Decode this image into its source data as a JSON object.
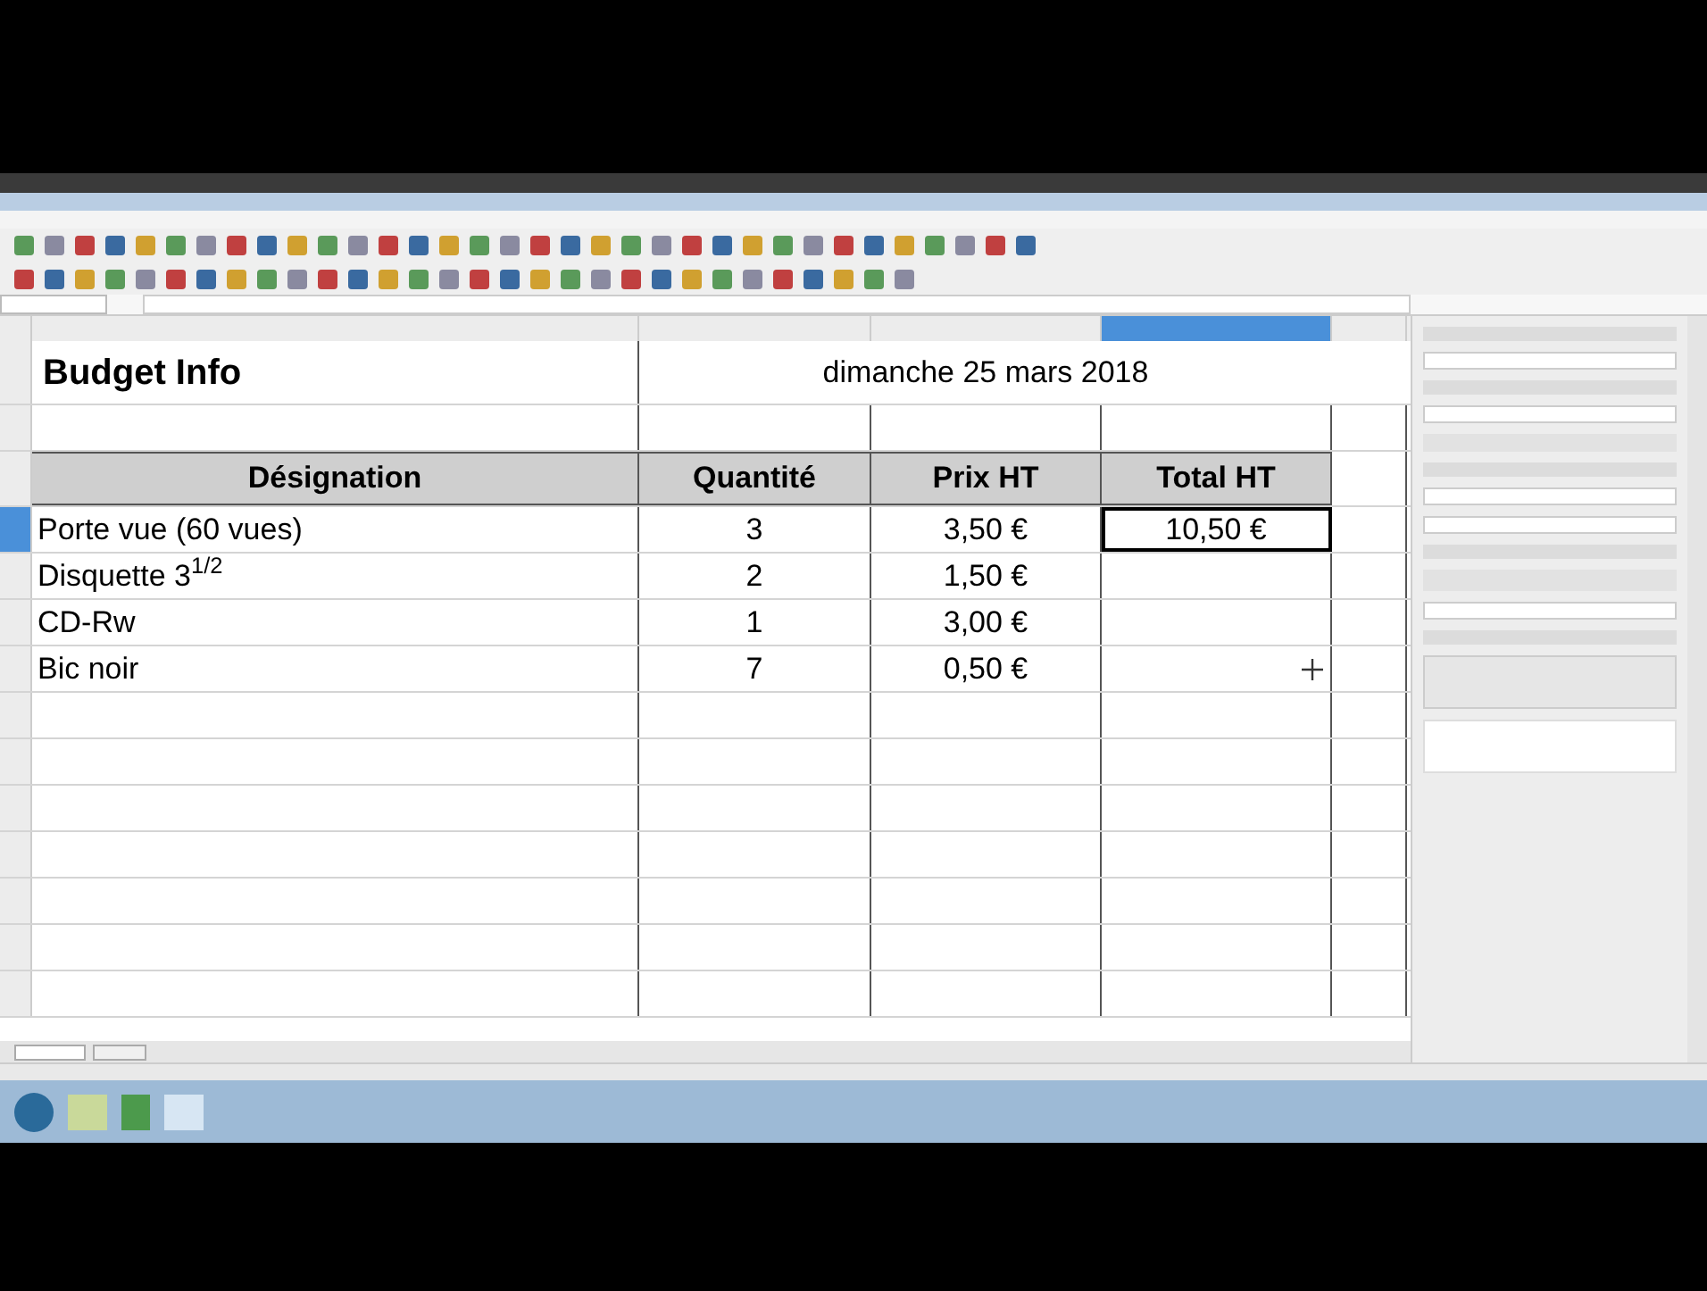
{
  "sheet": {
    "title_cell": "Budget Info",
    "date_cell": "dimanche 25 mars 2018",
    "columns": [
      {
        "selected": false
      },
      {
        "selected": false
      },
      {
        "selected": false
      },
      {
        "selected": true
      },
      {
        "selected": false
      }
    ],
    "header_row": [
      "Désignation",
      "Quantité",
      "Prix HT",
      "Total HT"
    ],
    "rows": [
      {
        "selected": true,
        "cells": [
          "Porte vue (60 vues)",
          "3",
          "3,50 €",
          "10,50 €"
        ]
      },
      {
        "selected": false,
        "cells": [
          "Disquette 3$^{1/2}$",
          "2",
          "1,50 €",
          ""
        ]
      },
      {
        "selected": false,
        "cells": [
          "CD-Rw",
          "1",
          "3,00 €",
          ""
        ]
      },
      {
        "selected": false,
        "cells": [
          "Bic noir",
          "7",
          "0,50 €",
          ""
        ]
      }
    ]
  }
}
